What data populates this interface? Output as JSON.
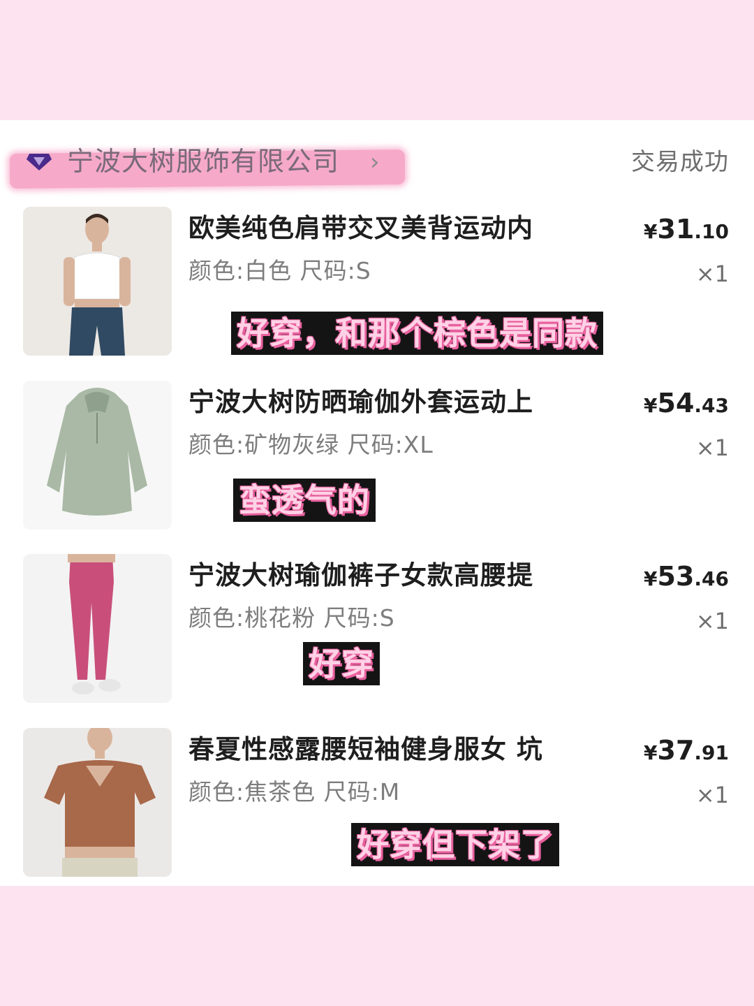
{
  "shop": {
    "name": "宁波大树服饰有限公司",
    "chevron": "›",
    "status": "交易成功"
  },
  "items": [
    {
      "title": "欧美纯色肩带交叉美背运动内",
      "spec": "颜色:白色 尺码:S",
      "price": {
        "currency": "¥",
        "int": "31",
        "dec": ".10"
      },
      "qty": "×1",
      "comment": "好穿，和那个棕色是同款"
    },
    {
      "title": "宁波大树防晒瑜伽外套运动上",
      "spec": "颜色:矿物灰绿 尺码:XL",
      "price": {
        "currency": "¥",
        "int": "54",
        "dec": ".43"
      },
      "qty": "×1",
      "comment": "蛮透气的"
    },
    {
      "title": "宁波大树瑜伽裤子女款高腰提",
      "spec": "颜色:桃花粉 尺码:S",
      "price": {
        "currency": "¥",
        "int": "53",
        "dec": ".46"
      },
      "qty": "×1",
      "comment": "好穿"
    },
    {
      "title": "春夏性感露腰短袖健身服女 坑",
      "spec": "颜色:焦茶色 尺码:M",
      "price": {
        "currency": "¥",
        "int": "37",
        "dec": ".91"
      },
      "qty": "×1",
      "comment": "好穿但下架了"
    }
  ],
  "colors": {
    "page_background": "#fde3ef",
    "card_background": "#ffffff",
    "highlight_pink": "#f6a9c9",
    "comment_bg": "#141414",
    "comment_text": "#ffd2e6",
    "comment_shadow": "#e8609e"
  }
}
